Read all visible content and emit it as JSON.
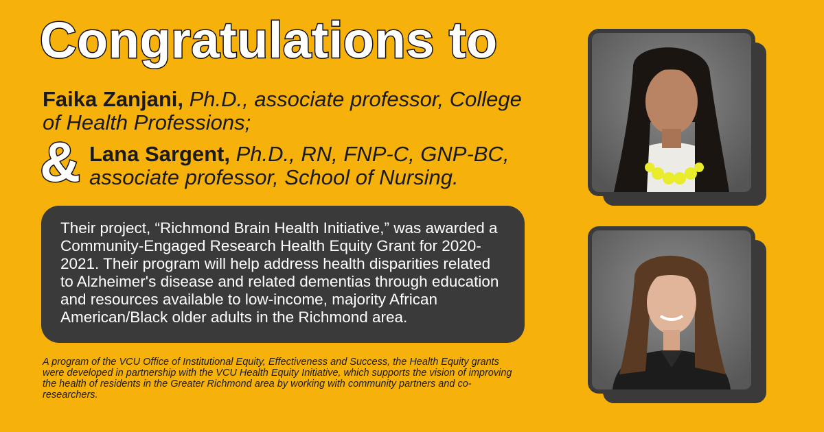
{
  "headline": "Congratulations to",
  "person1": {
    "name": "Faika Zanjani,",
    "title": " Ph.D., associate professor, College of Health Professions;"
  },
  "ampersand": "&",
  "person2": {
    "name": "Lana Sargent,",
    "title": " Ph.D., RN, FNP-C, GNP-BC, associate professor, School of Nursing."
  },
  "description": "Their project, “Richmond Brain Health Initiative,” was awarded a Community-Engaged Research Health Equity Grant for 2020-2021. Their program will help address health disparities related to Alzheimer's disease and related dementias through education and resources available to low-income, majority African American/Black older adults in the Richmond area.",
  "footnote": "A program of the VCU Office of Institutional Equity, Effectiveness and Success, the Health Equity grants were developed in partnership with the VCU Health Equity Initiative, which supports the vision of improving the health of residents in the Greater Richmond area by working with community partners and co-researchers.",
  "colors": {
    "background": "#F7B10B",
    "panel": "#3a3a3a",
    "text_dark": "#1a1a1a",
    "text_light": "#ffffff"
  }
}
